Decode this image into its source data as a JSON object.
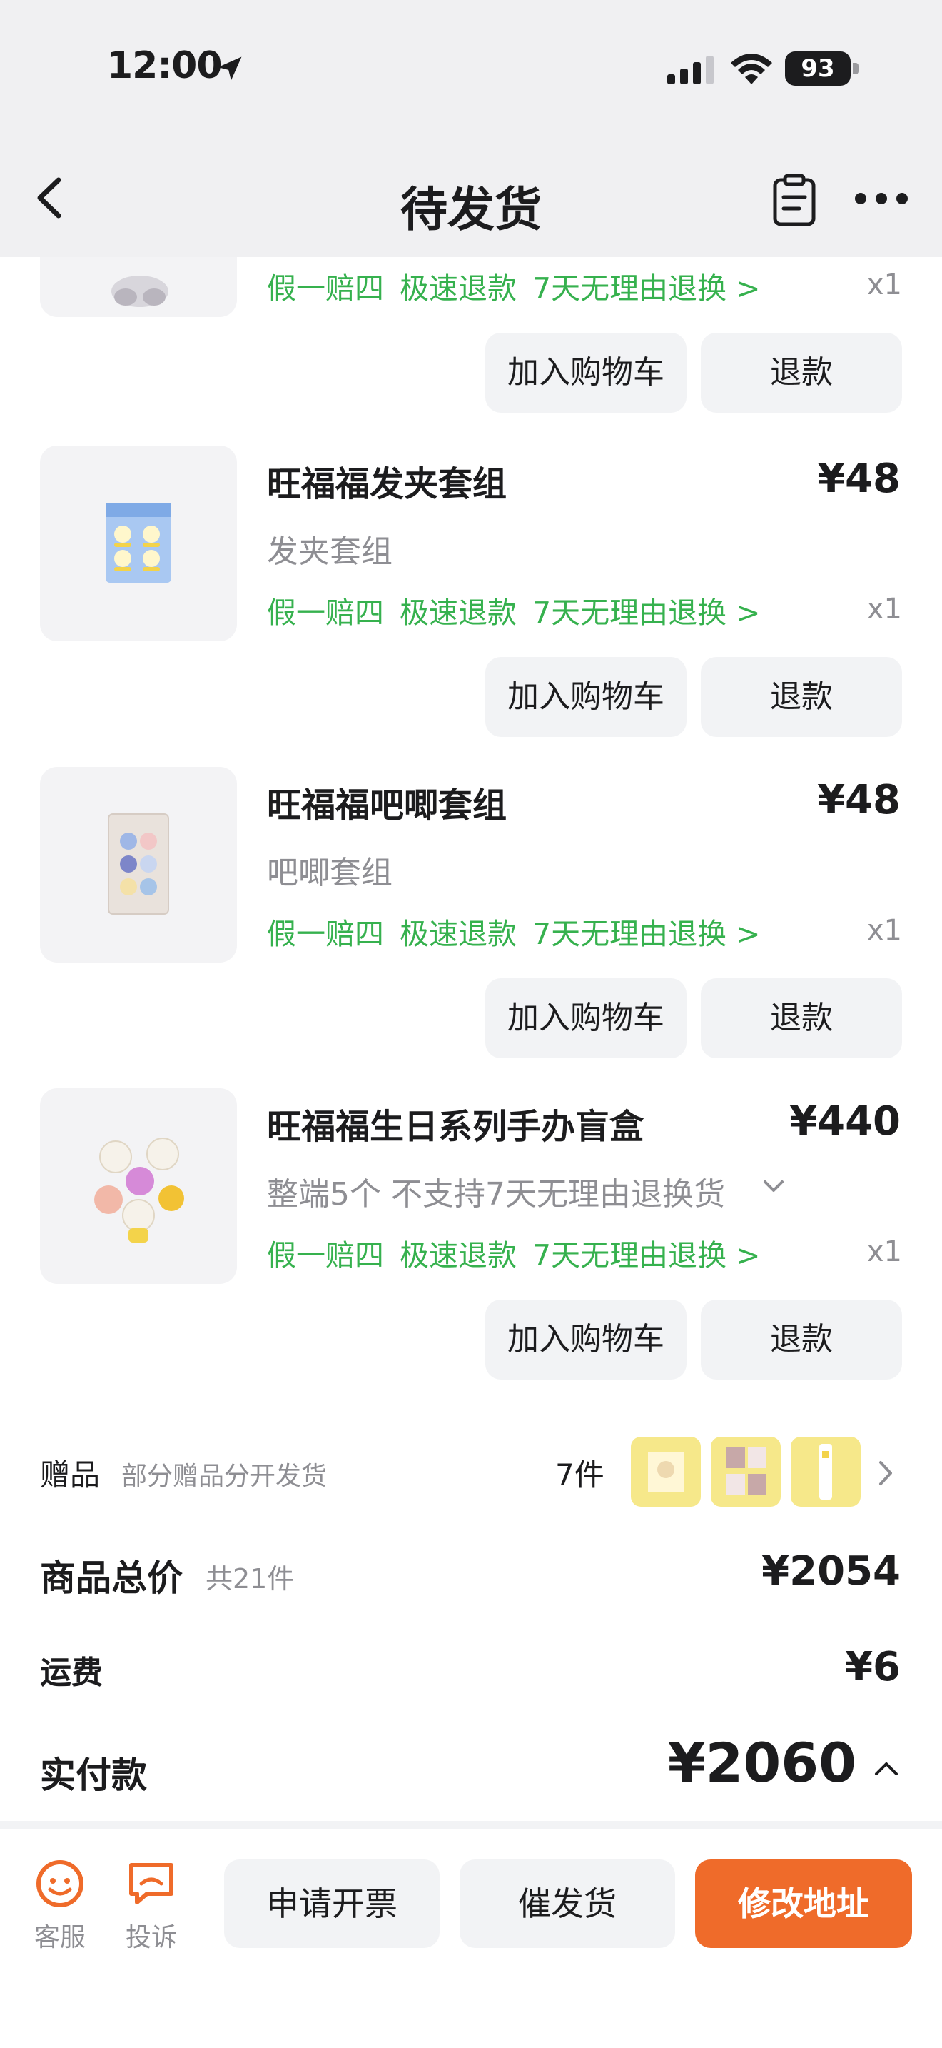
{
  "status_bar": {
    "time": "12:00",
    "battery": "93"
  },
  "nav": {
    "title": "待发货"
  },
  "items": [
    {
      "title": "",
      "price": "",
      "spec": "",
      "guarantees": [
        "假一赔四",
        "极速退款",
        "7天无理由退换 >"
      ],
      "qty": "x1",
      "cart_label": "加入购物车",
      "refund_label": "退款"
    },
    {
      "title": "旺福福发夹套组",
      "price": "¥48",
      "spec": "发夹套组",
      "guarantees": [
        "假一赔四",
        "极速退款",
        "7天无理由退换 >"
      ],
      "qty": "x1",
      "cart_label": "加入购物车",
      "refund_label": "退款"
    },
    {
      "title": "旺福福吧唧套组",
      "price": "¥48",
      "spec": "吧唧套组",
      "guarantees": [
        "假一赔四",
        "极速退款",
        "7天无理由退换 >"
      ],
      "qty": "x1",
      "cart_label": "加入购物车",
      "refund_label": "退款"
    },
    {
      "title": "旺福福生日系列手办盲盒",
      "price": "¥440",
      "spec": "整端5个 不支持7天无理由退换货",
      "guarantees": [
        "假一赔四",
        "极速退款",
        "7天无理由退换 >"
      ],
      "qty": "x1",
      "cart_label": "加入购物车",
      "refund_label": "退款"
    }
  ],
  "gifts": {
    "label": "赠品",
    "note": "部分赠品分开发货",
    "count": "7件"
  },
  "totals": {
    "goods_label": "商品总价",
    "goods_count": "共21件",
    "goods_value": "¥2054",
    "shipping_label": "运费",
    "shipping_value": "¥6",
    "paid_label": "实付款",
    "paid_value": "¥2060"
  },
  "bottom": {
    "service_label": "客服",
    "complain_label": "投诉",
    "invoice_label": "申请开票",
    "urge_label": "催发货",
    "address_label": "修改地址"
  },
  "colors": {
    "accent": "#ef6b2a",
    "guarantee_green": "#36b14e",
    "button_gray": "#f2f3f5",
    "header_bg": "#f0f0f2"
  }
}
